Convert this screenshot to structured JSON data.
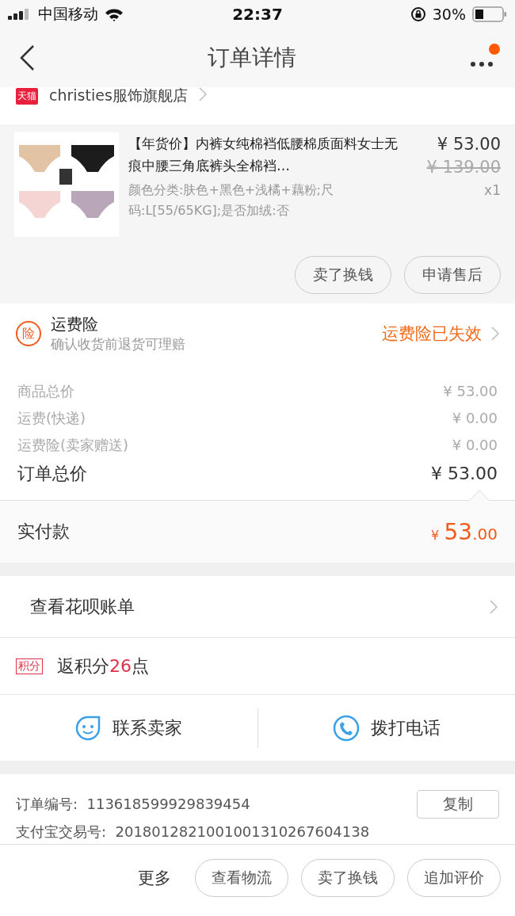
{
  "status_bar": {
    "carrier": "中国移动",
    "time": "22:37",
    "battery": "30%"
  },
  "nav": {
    "title": "订单详情",
    "has_notification": true
  },
  "shop": {
    "badge": "天猫",
    "name": "christies服饰旗舰店"
  },
  "item": {
    "image": {
      "kind": "picture"
    },
    "title": "【年货价】内裤女纯棉裆低腰棉质面料女士无痕中腰三角底裤头全棉裆…",
    "specs": "颜色分类:肤色+黑色+浅橘+藕粉;尺码:L[55/65KG];是否加绒:否",
    "price": "¥ 53.00",
    "original_price": "¥ 139.00",
    "quantity": "x1",
    "actions": [
      "卖了换钱",
      "申请售后"
    ]
  },
  "insurance": {
    "icon_text": "险",
    "title": "运费险",
    "subtitle": "确认收货前退货可理赔",
    "status": "运费险已失效"
  },
  "price_rows": [
    {
      "label": "商品总价",
      "value": "¥ 53.00",
      "kind": "detail"
    },
    {
      "label": "运费(快递)",
      "value": "¥ 0.00",
      "kind": "detail"
    },
    {
      "label": "运费险(卖家赠送)",
      "value": "¥ 0.00",
      "kind": "detail"
    },
    {
      "label": "订单总价",
      "value": "¥ 53.00",
      "kind": "total"
    }
  ],
  "paid": {
    "label": "实付款",
    "currency": "¥",
    "integer": "53",
    "decimal": ".00"
  },
  "huabei": {
    "label": "查看花呗账单"
  },
  "points": {
    "badge": "积分",
    "prefix": "返积分",
    "count": "26",
    "suffix": "点"
  },
  "contact": [
    {
      "label": "联系卖家",
      "kind": "chat"
    },
    {
      "label": "拨打电话",
      "kind": "phone"
    }
  ],
  "order_info": [
    {
      "label": "订单编号:",
      "value": "113618599929839454",
      "copy": "复制"
    },
    {
      "label": "支付宝交易号:",
      "value": "2018012821001001310267604138"
    }
  ],
  "bottom_bar": {
    "more": "更多",
    "buttons": [
      "查看物流",
      "卖了换钱",
      "追加评价"
    ]
  }
}
